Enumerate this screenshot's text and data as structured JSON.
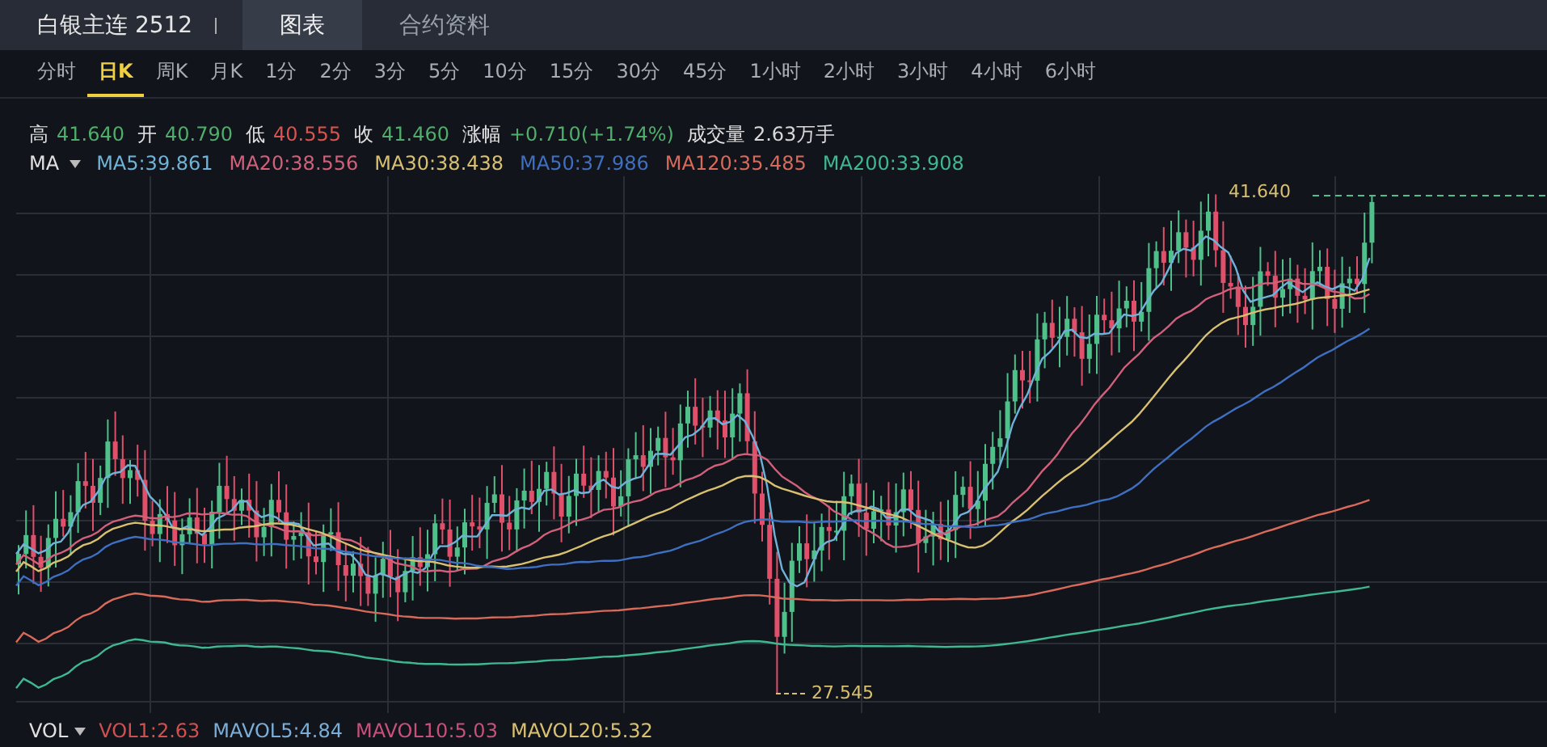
{
  "header": {
    "title": "白银主连 2512",
    "tabs": [
      {
        "label": "图表",
        "selected": true
      },
      {
        "label": "合约资料",
        "selected": false
      }
    ]
  },
  "periods": [
    {
      "label": "分时",
      "selected": false
    },
    {
      "label": "日K",
      "selected": true
    },
    {
      "label": "周K",
      "selected": false
    },
    {
      "label": "月K",
      "selected": false
    },
    {
      "label": "1分",
      "selected": false
    },
    {
      "label": "2分",
      "selected": false
    },
    {
      "label": "3分",
      "selected": false
    },
    {
      "label": "5分",
      "selected": false
    },
    {
      "label": "10分",
      "selected": false
    },
    {
      "label": "15分",
      "selected": false
    },
    {
      "label": "30分",
      "selected": false
    },
    {
      "label": "45分",
      "selected": false
    },
    {
      "label": "1小时",
      "selected": false
    },
    {
      "label": "2小时",
      "selected": false
    },
    {
      "label": "3小时",
      "selected": false
    },
    {
      "label": "4小时",
      "selected": false
    },
    {
      "label": "6小时",
      "selected": false
    }
  ],
  "quote": [
    {
      "label": "高",
      "value": "41.640",
      "color": "#4fae6a"
    },
    {
      "label": "开",
      "value": "40.790",
      "color": "#4fae6a"
    },
    {
      "label": "低",
      "value": "40.555",
      "color": "#d9534f"
    },
    {
      "label": "收",
      "value": "41.460",
      "color": "#4fae6a"
    },
    {
      "label": "涨幅",
      "value": "+0.710(+1.74%)",
      "color": "#4fae6a"
    },
    {
      "label": "成交量",
      "value": "2.63万手",
      "color": "#d8d8d8"
    }
  ],
  "indicators": {
    "label": "MA",
    "values": [
      {
        "text": "MA5:39.861",
        "color": "#6fb3d8"
      },
      {
        "text": "MA20:38.556",
        "color": "#d2607a"
      },
      {
        "text": "MA30:38.438",
        "color": "#d8c070"
      },
      {
        "text": "MA50:37.986",
        "color": "#3f6fc0"
      },
      {
        "text": "MA120:35.485",
        "color": "#d86a5a"
      },
      {
        "text": "MA200:33.908",
        "color": "#3fb891"
      }
    ]
  },
  "chart": {
    "high_label": "41.640",
    "low_label": "27.545"
  },
  "volume": {
    "label": "VOL",
    "values": [
      {
        "text": "VOL1:2.63",
        "color": "#d05050"
      },
      {
        "text": "MAVOL5:4.84",
        "color": "#7aaed8"
      },
      {
        "text": "MAVOL10:5.03",
        "color": "#c8507a"
      },
      {
        "text": "MAVOL20:5.32",
        "color": "#d8c070"
      }
    ]
  }
}
